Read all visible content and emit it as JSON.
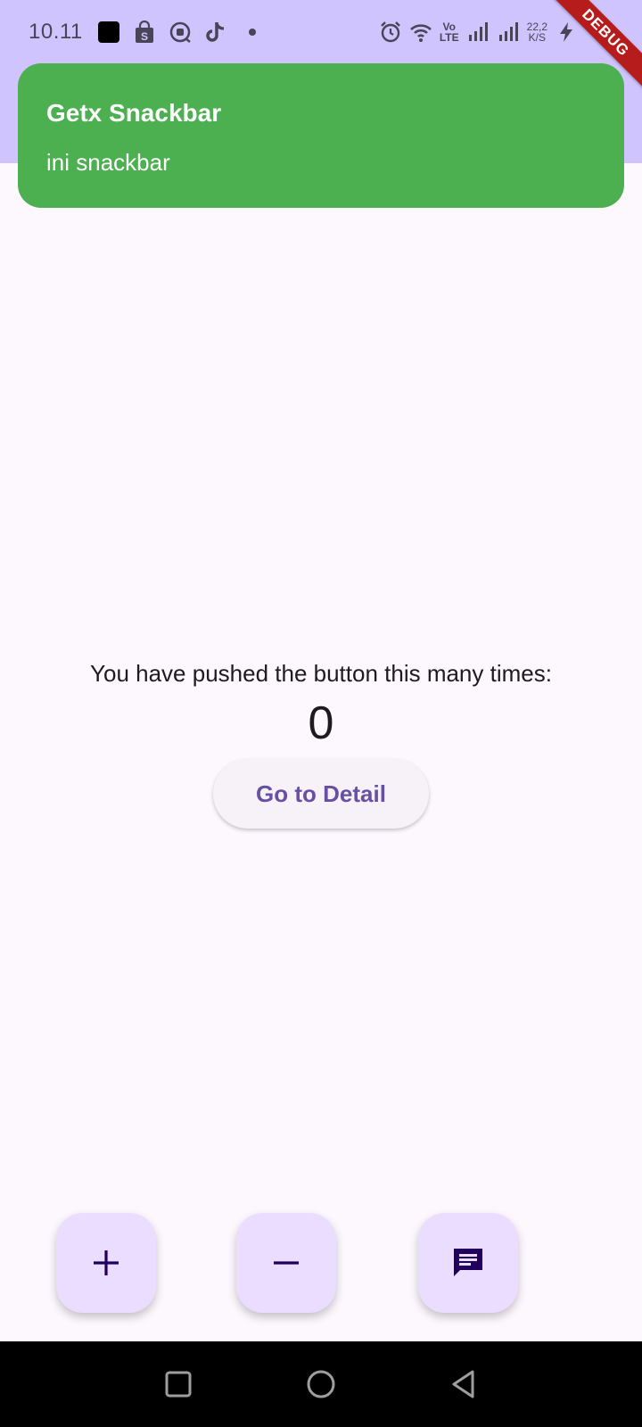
{
  "status_bar": {
    "time": "10.11",
    "icons": [
      "app-square-icon",
      "shopee-bag-icon",
      "chat-bubble-icon",
      "tiktok-icon",
      "dot-icon"
    ],
    "right_icons": [
      "alarm-icon",
      "wifi-icon",
      "volte-icon",
      "signal-icon",
      "signal-icon",
      "net-speed",
      "charging-icon",
      "battery-icon"
    ],
    "volte_top": "Vo",
    "volte_bottom": "LTE",
    "net_speed_value": "22,2",
    "net_speed_unit": "K/S"
  },
  "debug_banner": "DEBUG",
  "snackbar": {
    "title": "Getx Snackbar",
    "message": "ini snackbar",
    "background": "#4caf50"
  },
  "counter": {
    "label": "You have pushed the button this many times:",
    "value": "0"
  },
  "detail_button": {
    "label": "Go to Detail"
  },
  "fabs": [
    {
      "icon": "add-icon"
    },
    {
      "icon": "remove-icon"
    },
    {
      "icon": "message-icon"
    }
  ],
  "nav_bar": {
    "buttons": [
      "recents-icon",
      "home-icon",
      "back-icon"
    ]
  },
  "colors": {
    "app_bar": "#cfc4fd",
    "background": "#fdf7fe",
    "fab": "#eaddff",
    "primary": "#6750a4",
    "debug": "#b71c1c"
  }
}
